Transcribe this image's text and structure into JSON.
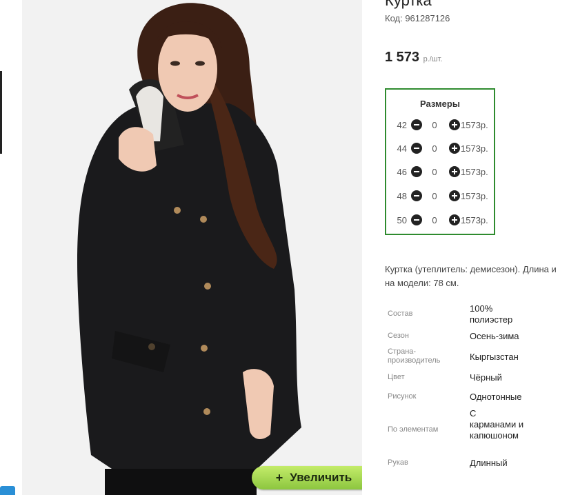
{
  "product": {
    "title_partial": "Куртка",
    "code": "Код: 961287126",
    "price": "1 573",
    "price_unit": "р./шт."
  },
  "sizes": {
    "heading": "Размеры",
    "rows": [
      {
        "size": "42",
        "qty": "0",
        "price": "1573р."
      },
      {
        "size": "44",
        "qty": "0",
        "price": "1573р."
      },
      {
        "size": "46",
        "qty": "0",
        "price": "1573р."
      },
      {
        "size": "48",
        "qty": "0",
        "price": "1573р."
      },
      {
        "size": "50",
        "qty": "0",
        "price": "1573р."
      }
    ]
  },
  "description": {
    "line1": "Куртка (утеплитель: демисезон). Длина и",
    "line2": "на модели: 78 см."
  },
  "specs": [
    {
      "label": "Состав",
      "value": "100% полиэстер"
    },
    {
      "label": "Сезон",
      "value": "Осень-зима"
    },
    {
      "label": "Страна-производитель",
      "value": "Кыргызстан"
    },
    {
      "label": "Цвет",
      "value": "Чёрный"
    },
    {
      "label": "Рисунок",
      "value": "Однотонные"
    },
    {
      "label": "По элементам",
      "value": "С карманами и капюшоном"
    },
    {
      "label": "Рукав",
      "value": "Длинный"
    }
  ],
  "zoom_button": {
    "label": "Увеличить",
    "icon": "plus-icon"
  },
  "colors": {
    "size_box_border": "#2e8b2e",
    "zoom_button": "#8cc63f"
  }
}
